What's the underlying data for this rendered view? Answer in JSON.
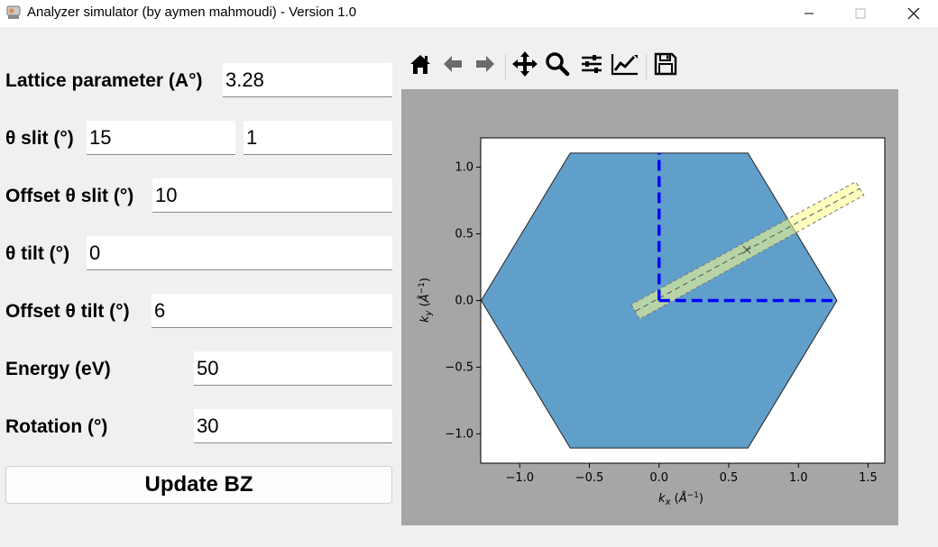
{
  "window": {
    "title": "Analyzer simulator  (by aymen mahmoudi) - Version 1.0",
    "icon": "app-icon",
    "controls": [
      "minimize-icon",
      "maximize-icon",
      "close-icon"
    ]
  },
  "form": {
    "lattice": {
      "label": "Lattice parameter (A°)",
      "value": "3.28"
    },
    "theta_slit": {
      "label": "θ slit (°)",
      "value1": "15",
      "value2": "1"
    },
    "offset_theta_slit": {
      "label": "Offset θ slit (°)",
      "value": "10"
    },
    "theta_tilt": {
      "label": "θ tilt (°)",
      "value": "0"
    },
    "offset_theta_tilt": {
      "label": "Offset θ tilt (°)",
      "value": "6"
    },
    "energy": {
      "label": "Energy (eV)",
      "value": "50"
    },
    "rotation": {
      "label": "Rotation (°)",
      "value": "30"
    },
    "update_label": "Update BZ"
  },
  "toolbar": {
    "tools": [
      "home-icon",
      "back-icon",
      "forward-icon",
      "pan-icon",
      "zoom-icon",
      "configure-icon",
      "edit-axis-icon",
      "save-icon"
    ]
  },
  "chart_data": {
    "type": "scatter",
    "xlabel": "k_x (Å⁻¹)",
    "ylabel": "k_y (Å⁻¹)",
    "xlim": [
      -1.28,
      1.62
    ],
    "ylim": [
      -1.22,
      1.22
    ],
    "xticks": [
      -1.0,
      -0.5,
      0.0,
      0.5,
      1.0,
      1.5
    ],
    "xtick_labels": [
      "−1.0",
      "−0.5",
      "0.0",
      "0.5",
      "1.0",
      "1.5"
    ],
    "yticks": [
      -1.0,
      -0.5,
      0.0,
      0.5,
      1.0
    ],
    "ytick_labels": [
      "−1.0",
      "−0.5",
      "0.0",
      "0.5",
      "1.0"
    ],
    "grid": false,
    "colors": {
      "zone_fill": "#619fcb",
      "axes_lines": "#0000ff",
      "slit_fill": "#ffff88",
      "slit_edge": "#777777"
    },
    "brillouin_zone": {
      "vertices": [
        [
          1.277,
          0.0
        ],
        [
          0.638,
          1.106
        ],
        [
          -0.638,
          1.106
        ],
        [
          -1.277,
          0.0
        ],
        [
          -0.638,
          -1.106
        ],
        [
          0.638,
          -1.106
        ]
      ]
    },
    "axes_lines": [
      {
        "from": [
          0.0,
          0.0
        ],
        "to": [
          0.0,
          1.106
        ]
      },
      {
        "from": [
          0.0,
          0.0
        ],
        "to": [
          1.277,
          0.0
        ]
      }
    ],
    "slit": {
      "center_line": {
        "from": [
          -0.17,
          -0.08
        ],
        "to": [
          1.44,
          0.84
        ]
      },
      "polygon": [
        [
          -0.2,
          -0.03
        ],
        [
          -0.14,
          -0.14
        ],
        [
          1.47,
          0.79
        ],
        [
          1.41,
          0.89
        ]
      ],
      "center_point": [
        0.63,
        0.38
      ]
    }
  }
}
